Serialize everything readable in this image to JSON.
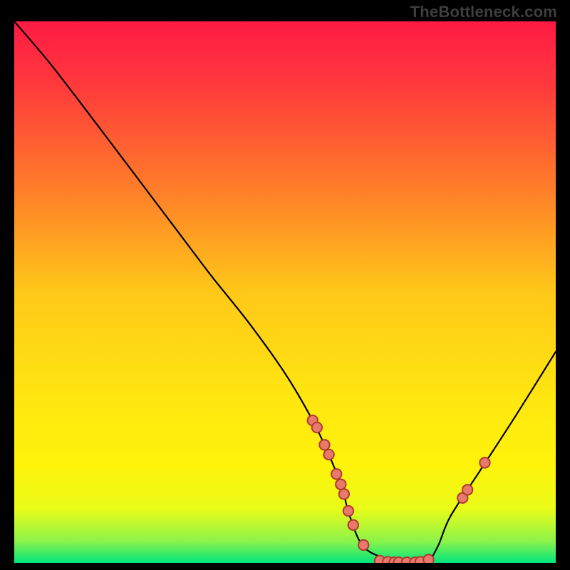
{
  "watermark": "TheBottleneck.com",
  "chart_data": {
    "type": "line",
    "title": "",
    "xlabel": "",
    "ylabel": "",
    "xlim": [
      0,
      100
    ],
    "ylim": [
      0,
      100
    ],
    "grid": false,
    "legend": false,
    "gradient_stops": [
      {
        "offset": 0.0,
        "color": "#ff1a44"
      },
      {
        "offset": 0.12,
        "color": "#ff3a3c"
      },
      {
        "offset": 0.3,
        "color": "#ff7a2a"
      },
      {
        "offset": 0.5,
        "color": "#ffc819"
      },
      {
        "offset": 0.7,
        "color": "#ffe710"
      },
      {
        "offset": 0.82,
        "color": "#fff30a"
      },
      {
        "offset": 0.9,
        "color": "#eafc18"
      },
      {
        "offset": 0.96,
        "color": "#8cf34a"
      },
      {
        "offset": 1.0,
        "color": "#00e57d"
      }
    ],
    "series": [
      {
        "name": "bottleneck-curve",
        "x": [
          0.0,
          6.8,
          16.0,
          22.8,
          29.6,
          36.4,
          43.2,
          50.0,
          55.0,
          58.0,
          60.5,
          62.0,
          65.0,
          72.0,
          76.0,
          78.2,
          80.5,
          86.0,
          92.5,
          100.0
        ],
        "y": [
          100.0,
          92.0,
          80.0,
          71.0,
          62.0,
          53.0,
          44.5,
          35.0,
          26.5,
          20.2,
          14.0,
          8.5,
          2.5,
          0.0,
          0.0,
          3.0,
          8.5,
          17.0,
          27.0,
          39.0
        ]
      }
    ],
    "markers": [
      {
        "x": 55.1,
        "y": 26.3
      },
      {
        "x": 55.9,
        "y": 25.0
      },
      {
        "x": 57.3,
        "y": 21.8
      },
      {
        "x": 58.1,
        "y": 20.0
      },
      {
        "x": 59.5,
        "y": 16.4
      },
      {
        "x": 60.3,
        "y": 14.5
      },
      {
        "x": 60.9,
        "y": 12.7
      },
      {
        "x": 61.7,
        "y": 9.6
      },
      {
        "x": 62.6,
        "y": 7.0
      },
      {
        "x": 64.5,
        "y": 3.3
      },
      {
        "x": 67.5,
        "y": 0.4
      },
      {
        "x": 69.0,
        "y": 0.2
      },
      {
        "x": 70.2,
        "y": 0.1
      },
      {
        "x": 71.0,
        "y": 0.1
      },
      {
        "x": 72.5,
        "y": 0.1
      },
      {
        "x": 74.0,
        "y": 0.1
      },
      {
        "x": 75.0,
        "y": 0.2
      },
      {
        "x": 76.5,
        "y": 0.6
      },
      {
        "x": 82.8,
        "y": 12.0
      },
      {
        "x": 83.7,
        "y": 13.5
      },
      {
        "x": 86.9,
        "y": 18.5
      }
    ],
    "marker_style": {
      "stroke": "#b03a2e",
      "fill": "#e77a6d",
      "stroke_width": 2
    },
    "curve_style": {
      "stroke": "#000000",
      "stroke_width": 2.2
    }
  }
}
